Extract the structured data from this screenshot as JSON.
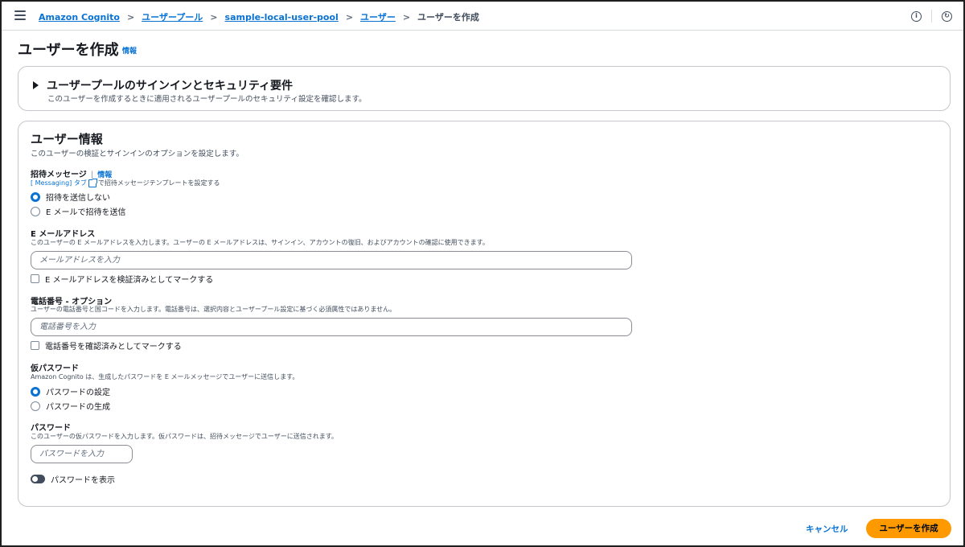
{
  "breadcrumb": {
    "items": [
      "Amazon Cognito",
      "ユーザープール",
      "sample-local-user-pool",
      "ユーザー"
    ],
    "current": "ユーザーを作成"
  },
  "page": {
    "title": "ユーザーを作成",
    "info": "情報"
  },
  "security_panel": {
    "title": "ユーザープールのサインインとセキュリティ要件",
    "description": "このユーザーを作成するときに適用されるユーザープールのセキュリティ設定を確認します。"
  },
  "user_info": {
    "title": "ユーザー情報",
    "description": "このユーザーの検証とサインインのオプションを設定します。",
    "invitation": {
      "label": "招待メッセージ",
      "info": "情報",
      "hint_link": "[ Messaging] タブ",
      "hint_text": "で招待メッセージテンプレートを設定する",
      "options": [
        "招待を送信しない",
        "E メールで招待を送信"
      ],
      "selected": 0
    },
    "email": {
      "label": "E メールアドレス",
      "description": "このユーザーの E メールアドレスを入力します。ユーザーの E メールアドレスは、サインイン、アカウントの復旧、およびアカウントの確認に使用できます。",
      "placeholder": "メールアドレスを入力",
      "verify_label": "E メールアドレスを検証済みとしてマークする"
    },
    "phone": {
      "label": "電話番号 - オプション",
      "description": "ユーザーの電話番号と国コードを入力します。電話番号は、選択内容とユーザープール設定に基づく必須属性ではありません。",
      "placeholder": "電話番号を入力",
      "verify_label": "電話番号を確認済みとしてマークする"
    },
    "temp_password": {
      "label": "仮パスワード",
      "description": "Amazon Cognito は、生成したパスワードを E メールメッセージでユーザーに送信します。",
      "options": [
        "パスワードの設定",
        "パスワードの生成"
      ],
      "selected": 0
    },
    "password": {
      "label": "パスワード",
      "description": "このユーザーの仮パスワードを入力します。仮パスワードは、招待メッセージでユーザーに送信されます。",
      "placeholder": "パスワードを入力",
      "show_label": "パスワードを表示"
    }
  },
  "actions": {
    "cancel": "キャンセル",
    "create": "ユーザーを作成"
  }
}
